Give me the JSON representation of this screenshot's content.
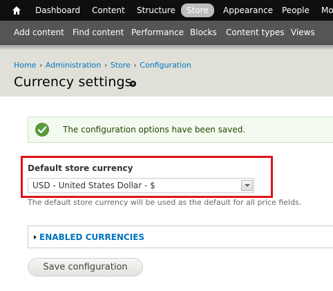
{
  "toolbar": {
    "items": [
      {
        "label": "Dashboard"
      },
      {
        "label": "Content"
      },
      {
        "label": "Structure"
      },
      {
        "label": "Store",
        "active": true
      },
      {
        "label": "Appearance"
      },
      {
        "label": "People"
      },
      {
        "label": "Mo"
      }
    ]
  },
  "shortcuts": {
    "items": [
      {
        "label": "Add content"
      },
      {
        "label": "Find content"
      },
      {
        "label": "Performance"
      },
      {
        "label": "Blocks"
      },
      {
        "label": "Content types"
      },
      {
        "label": "Views"
      }
    ]
  },
  "breadcrumb": {
    "items": [
      "Home",
      "Administration",
      "Store",
      "Configuration"
    ],
    "separator": "›"
  },
  "page": {
    "title": "Currency settings"
  },
  "status": {
    "message": "The configuration options have been saved."
  },
  "form": {
    "currency_label": "Default store currency",
    "currency_value": "USD - United States Dollar - $",
    "currency_description": "The default store currency will be used as the default for all price fields.",
    "enabled_currencies_legend": "ENABLED CURRENCIES",
    "save_label": "Save configuration"
  },
  "colors": {
    "highlight": "#e01218",
    "link": "#0074bd",
    "status_icon": "#5b9a3a"
  }
}
